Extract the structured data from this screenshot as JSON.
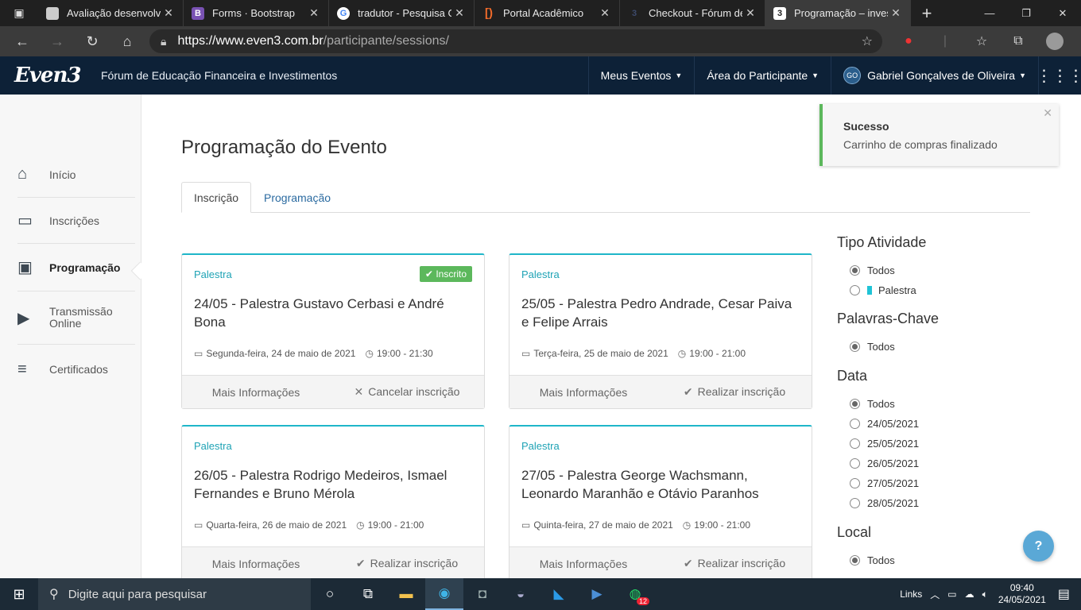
{
  "browser": {
    "tabs": [
      {
        "title": "Avaliação desenvolvim",
        "icon": "notebook-icon",
        "color": "#cccccc"
      },
      {
        "title": "Forms · Bootstrap",
        "icon": "bootstrap-icon",
        "color": "#7952b3"
      },
      {
        "title": "tradutor - Pesquisa Go",
        "icon": "google-icon",
        "color": "#ffffff"
      },
      {
        "title": "Portal Acadêmico",
        "icon": "portal-icon",
        "color": "#f06a2a"
      },
      {
        "title": "Checkout - Fórum de",
        "icon": "even3-icon",
        "color": "#3d4a6b"
      },
      {
        "title": "Programação – invest",
        "icon": "even3-icon",
        "color": "#ffffff"
      }
    ],
    "url_host": "https://www.even3.com.br",
    "url_path": "/participante/sessions/"
  },
  "header": {
    "logo": "Even3",
    "event_name": "Fórum de Educação Financeira e Investimentos",
    "menu_events": "Meus Eventos",
    "menu_participant": "Área do Participante",
    "user_initials": "GO",
    "user_name": "Gabriel Gonçalves de Oliveira"
  },
  "sidebar": {
    "items": [
      {
        "label": "Início",
        "icon": "home-icon"
      },
      {
        "label": "Inscrições",
        "icon": "ticket-icon"
      },
      {
        "label": "Programação",
        "icon": "calendar-icon"
      },
      {
        "label": "Transmissão Online",
        "icon": "play-icon"
      },
      {
        "label": "Certificados",
        "icon": "certificate-icon"
      }
    ]
  },
  "main": {
    "title": "Programação do Evento",
    "tabs": [
      "Inscrição",
      "Programação"
    ]
  },
  "cards": [
    {
      "type": "Palestra",
      "badge": "Inscrito",
      "title": "24/05 - Palestra Gustavo Cerbasi e André Bona",
      "date": "Segunda-feira, 24 de maio de 2021",
      "time": "19:00 - 21:30",
      "more": "Mais Informações",
      "action": "Cancelar inscrição",
      "action_icon": "✕"
    },
    {
      "type": "Palestra",
      "badge": "",
      "title": "25/05 - Palestra Pedro Andrade, Cesar Paiva e Felipe Arrais",
      "date": "Terça-feira, 25 de maio de 2021",
      "time": "19:00 - 21:00",
      "more": "Mais Informações",
      "action": "Realizar inscrição",
      "action_icon": "✔"
    },
    {
      "type": "Palestra",
      "badge": "",
      "title": "26/05 - Palestra Rodrigo Medeiros, Ismael Fernandes e Bruno Mérola",
      "date": "Quarta-feira, 26 de maio de 2021",
      "time": "19:00 - 21:00",
      "more": "Mais Informações",
      "action": "Realizar inscrição",
      "action_icon": "✔"
    },
    {
      "type": "Palestra",
      "badge": "",
      "title": "27/05 - Palestra George Wachsmann, Leonardo Maranhão e Otávio Paranhos",
      "date": "Quinta-feira, 27 de maio de 2021",
      "time": "19:00 - 21:00",
      "more": "Mais Informações",
      "action": "Realizar inscrição",
      "action_icon": "✔"
    }
  ],
  "filters": {
    "tipo_title": "Tipo Atividade",
    "tipo_options": [
      "Todos",
      "Palestra"
    ],
    "palavras_title": "Palavras-Chave",
    "palavras_options": [
      "Todos"
    ],
    "data_title": "Data",
    "data_options": [
      "Todos",
      "24/05/2021",
      "25/05/2021",
      "26/05/2021",
      "27/05/2021",
      "28/05/2021"
    ],
    "local_title": "Local",
    "local_options": [
      "Todos"
    ]
  },
  "toast": {
    "title": "Sucesso",
    "message": "Carrinho de compras finalizado"
  },
  "taskbar": {
    "search_placeholder": "Digite aqui para pesquisar",
    "links_label": "Links",
    "time": "09:40",
    "date": "24/05/2021",
    "whatsapp_badge": "12"
  }
}
